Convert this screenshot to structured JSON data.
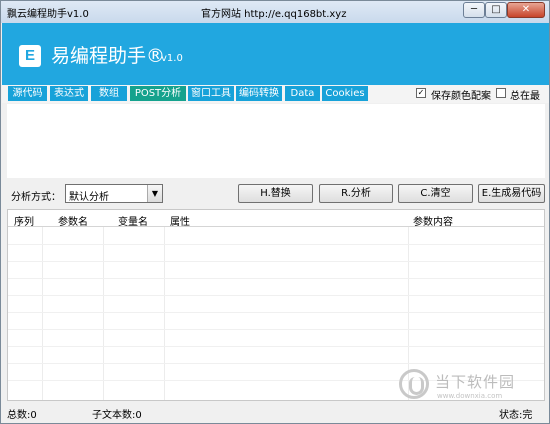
{
  "window": {
    "title": "飘云编程助手v1.0",
    "site_label": "官方网站 http://e.qq168bt.xyz",
    "minimize_glyph": "─",
    "maximize_glyph": "□",
    "close_glyph": "✕"
  },
  "header": {
    "logo_letter": "E",
    "app_name": "易编程助手®",
    "version": "v1.0",
    "background": "#21a7e0"
  },
  "tabs": [
    {
      "label": "源代码"
    },
    {
      "label": "表达式"
    },
    {
      "label": "数组"
    },
    {
      "label": "POST分析",
      "active": true
    },
    {
      "label": "窗口工具"
    },
    {
      "label": "编码转换"
    },
    {
      "label": "Data"
    },
    {
      "label": "Cookies"
    }
  ],
  "options": {
    "save_color": {
      "label": "保存颜色配案",
      "checked": true
    },
    "always_top": {
      "label": "总在最前",
      "checked": false
    }
  },
  "toolbar": {
    "mode_label": "分析方式：",
    "mode_value": "默认分析",
    "replace_button": "H.替换",
    "analyze_button": "R.分析",
    "clear_button": "C.清空",
    "generate_button": "E.生成易代码"
  },
  "table": {
    "columns": [
      "序列",
      "参数名",
      "变量名",
      "属性",
      "参数内容"
    ]
  },
  "watermark": {
    "text": "当下软件园",
    "url": "www.downxia.com"
  },
  "statusbar": {
    "total": "总数:0",
    "sub_text_count": "子文本数:0",
    "state": "状态:完"
  },
  "colors": {
    "tab": "#17a2d9",
    "tab_active": "#15a28d"
  }
}
